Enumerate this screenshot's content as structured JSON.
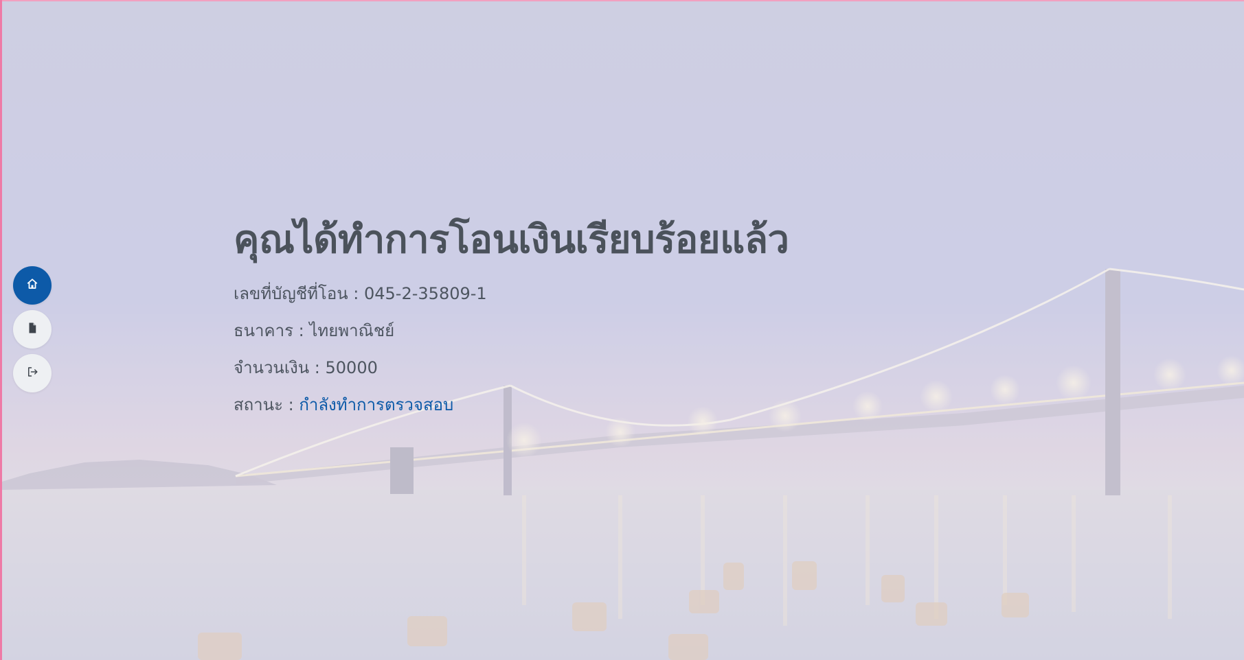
{
  "colors": {
    "accent": "#0d5aa8",
    "text": "#4b525b",
    "status": "#0d5aa8"
  },
  "nav": {
    "items": [
      {
        "icon": "home-icon",
        "active": true
      },
      {
        "icon": "document-icon",
        "active": false
      },
      {
        "icon": "logout-icon",
        "active": false
      }
    ]
  },
  "page": {
    "headline": "คุณได้ทำการโอนเงินเรียบร้อยแล้ว",
    "account": {
      "label": "เลขที่บัญชีที่โอน :",
      "value": "045-2-35809-1"
    },
    "bank": {
      "label": "ธนาคาร :",
      "value": "ไทยพาณิชย์"
    },
    "amount": {
      "label": "จำนวนเงิน :",
      "value": "50000"
    },
    "status": {
      "label": "สถานะ :",
      "value": "กำลังทำการตรวจสอบ"
    }
  }
}
